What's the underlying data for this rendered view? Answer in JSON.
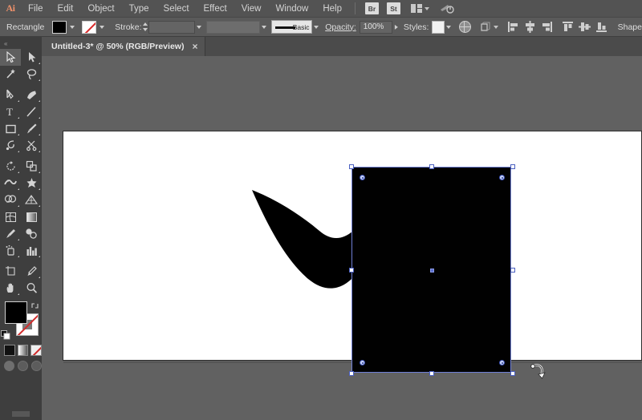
{
  "app": {
    "name": "Adobe Illustrator",
    "logo_text": "Ai",
    "accent_color": "#f0916a",
    "chrome_color": "#535353",
    "selection_color": "#6f7fd6"
  },
  "menubar": {
    "items": [
      {
        "label": "File"
      },
      {
        "label": "Edit"
      },
      {
        "label": "Object"
      },
      {
        "label": "Type"
      },
      {
        "label": "Select"
      },
      {
        "label": "Effect"
      },
      {
        "label": "View"
      },
      {
        "label": "Window"
      },
      {
        "label": "Help"
      }
    ],
    "bridge_label": "Br",
    "stock_label": "St",
    "arrange_icon": "arrange-documents-icon",
    "cc_icon": "creative-cloud-sync-icon"
  },
  "controlbar": {
    "selection_label": "Rectangle",
    "fill_swatch": "#000000",
    "fill_icon": "fill-color-swatch",
    "stroke_swatch": "none",
    "stroke_icon": "stroke-none-swatch",
    "stroke_label": "Stroke:",
    "stroke_weight_value": "",
    "stroke_weight_placeholder": "",
    "variable_width_value": "",
    "stroke_profile_label": "Basic",
    "opacity_label": "Opacity:",
    "opacity_value": "100%",
    "styles_label": "Styles:",
    "style_swatch": "#f2f2f2",
    "recolor_icon": "recolor-artwork-icon",
    "transform_icon": "transform-panel-icon",
    "align_icons": [
      "align-left-icon",
      "align-horizontal-center-icon",
      "align-right-icon",
      "align-top-icon",
      "align-vertical-center-icon",
      "align-bottom-icon"
    ],
    "shape_label": "Shape"
  },
  "tabbar": {
    "document_title": "Untitled-3* @ 50% (RGB/Preview)",
    "close_glyph": "×"
  },
  "toolbar": {
    "collapse_glyph": "«",
    "tools": [
      {
        "name": "selection-tool",
        "active": true
      },
      {
        "name": "direct-selection-tool",
        "active": false
      },
      {
        "name": "magic-wand-tool",
        "active": false
      },
      {
        "name": "lasso-tool",
        "active": false
      },
      {
        "name": "pen-tool",
        "active": false
      },
      {
        "name": "curvature-tool",
        "active": false
      },
      {
        "name": "type-tool",
        "active": false
      },
      {
        "name": "line-segment-tool",
        "active": false
      },
      {
        "name": "rectangle-tool",
        "active": false
      },
      {
        "name": "paintbrush-tool",
        "active": false
      },
      {
        "name": "shaper-tool",
        "active": false
      },
      {
        "name": "scissors-tool",
        "active": false
      },
      {
        "name": "rotate-tool",
        "active": false
      },
      {
        "name": "scale-tool",
        "active": false
      },
      {
        "name": "width-tool",
        "active": false
      },
      {
        "name": "free-transform-tool",
        "active": false
      },
      {
        "name": "shape-builder-tool",
        "active": false
      },
      {
        "name": "perspective-grid-tool",
        "active": false
      },
      {
        "name": "mesh-tool",
        "active": false
      },
      {
        "name": "gradient-tool",
        "active": false
      },
      {
        "name": "eyedropper-tool",
        "active": false
      },
      {
        "name": "blend-tool",
        "active": false
      },
      {
        "name": "symbol-sprayer-tool",
        "active": false
      },
      {
        "name": "column-graph-tool",
        "active": false
      },
      {
        "name": "artboard-tool",
        "active": false
      },
      {
        "name": "slice-tool",
        "active": false
      },
      {
        "name": "hand-tool",
        "active": false
      },
      {
        "name": "zoom-tool",
        "active": false
      }
    ],
    "fill_color": "#000000",
    "stroke_color": "none",
    "swap_icon": "swap-fill-stroke-icon",
    "default_icon": "default-fill-stroke-icon",
    "color_modes": [
      {
        "name": "color-mode-button",
        "type": "black"
      },
      {
        "name": "gradient-mode-button",
        "type": "gradient"
      },
      {
        "name": "none-mode-button",
        "type": "none"
      }
    ],
    "screen_modes": [
      {
        "name": "drawing-mode-normal-button",
        "on": true
      },
      {
        "name": "drawing-mode-behind-button",
        "on": false
      },
      {
        "name": "drawing-mode-inside-button",
        "on": false
      }
    ]
  },
  "canvas": {
    "artboard_background": "#ffffff",
    "canvas_background": "#616161",
    "artwork": [
      {
        "name": "wave-shape",
        "fill": "#000000",
        "description": "black flag wave shape"
      },
      {
        "name": "rectangle-shape",
        "fill": "#010101",
        "selected": true,
        "description": "black rectangle"
      }
    ],
    "selection": {
      "handle_count": 8,
      "anchor_count": 4,
      "has_center_point": true,
      "cursor": "rotate-cursor"
    }
  }
}
